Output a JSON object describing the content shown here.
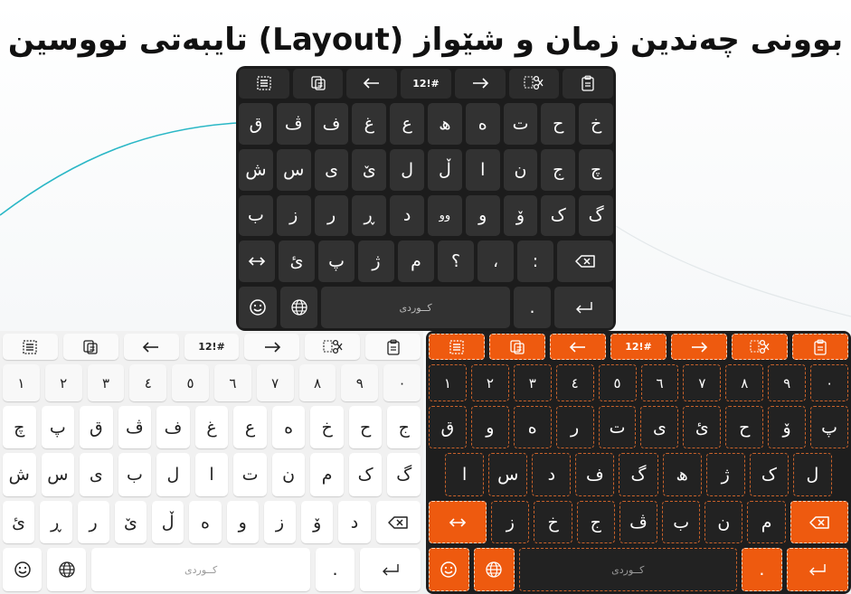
{
  "title": "بوونی چەندین زمان و شێواز (Layout) تایبەتی نووسین",
  "theme_colors": {
    "dark_background": "#1c1c1c",
    "dark_key": "#323232",
    "light_background": "#f1f1f1",
    "light_key": "#ffffff",
    "orange_accent": "#ee5a0f",
    "orange_dashed_border": "#c9622a",
    "decor_curve": "#2ab7c6"
  },
  "toolbar": {
    "icons": [
      "select-all-icon",
      "copy-icon",
      "arrow-left-icon",
      "numbers-key",
      "arrow-right-icon",
      "cut-icon",
      "paste-icon"
    ],
    "numbers_label": "12!#"
  },
  "keyboards": {
    "dark": {
      "rows": [
        [
          "خ",
          "ح",
          "ت",
          "ە",
          "ھ",
          "ع",
          "غ",
          "ف",
          "ڤ",
          "ق"
        ],
        [
          "چ",
          "ج",
          "ن",
          "ا",
          "ڵ",
          "ل",
          "ێ",
          "ی",
          "س",
          "ش"
        ],
        [
          "گ",
          "ک",
          "ۆ",
          "و",
          "وو",
          "د",
          "ڕ",
          "ر",
          "ز",
          "ب"
        ],
        [
          ":",
          "،",
          "؟",
          "م",
          "ژ",
          "پ",
          "ئ"
        ]
      ],
      "space_label": "کــوردی",
      "period": "."
    },
    "light": {
      "numbers": [
        "١",
        "٢",
        "٣",
        "٤",
        "٥",
        "٦",
        "٧",
        "٨",
        "٩",
        "٠"
      ],
      "rows": [
        [
          "ج",
          "ح",
          "خ",
          "ه",
          "ع",
          "غ",
          "ف",
          "ڤ",
          "ق",
          "پ",
          "چ"
        ],
        [
          "گ",
          "ک",
          "م",
          "ن",
          "ت",
          "ا",
          "ل",
          "ب",
          "ی",
          "س",
          "ش"
        ],
        [
          "د",
          "ۆ",
          "ز",
          "و",
          "ە",
          "ڵ",
          "ێ",
          "ر",
          "ڕ",
          "ئ"
        ]
      ],
      "space_label": "کــوردی",
      "period": "."
    },
    "orange": {
      "numbers": [
        "١",
        "٢",
        "٣",
        "٤",
        "٥",
        "٦",
        "٧",
        "٨",
        "٩",
        "٠"
      ],
      "rows": [
        [
          "پ",
          "ۆ",
          "ح",
          "ئ",
          "ی",
          "ت",
          "ر",
          "ە",
          "و",
          "ق"
        ],
        [
          "ل",
          "ک",
          "ژ",
          "ھ",
          "گ",
          "ف",
          "د",
          "س",
          "ا"
        ],
        [
          "م",
          "ن",
          "ب",
          "ڤ",
          "ج",
          "خ",
          "ز"
        ]
      ],
      "space_label": "کــوردی",
      "period": "."
    }
  }
}
